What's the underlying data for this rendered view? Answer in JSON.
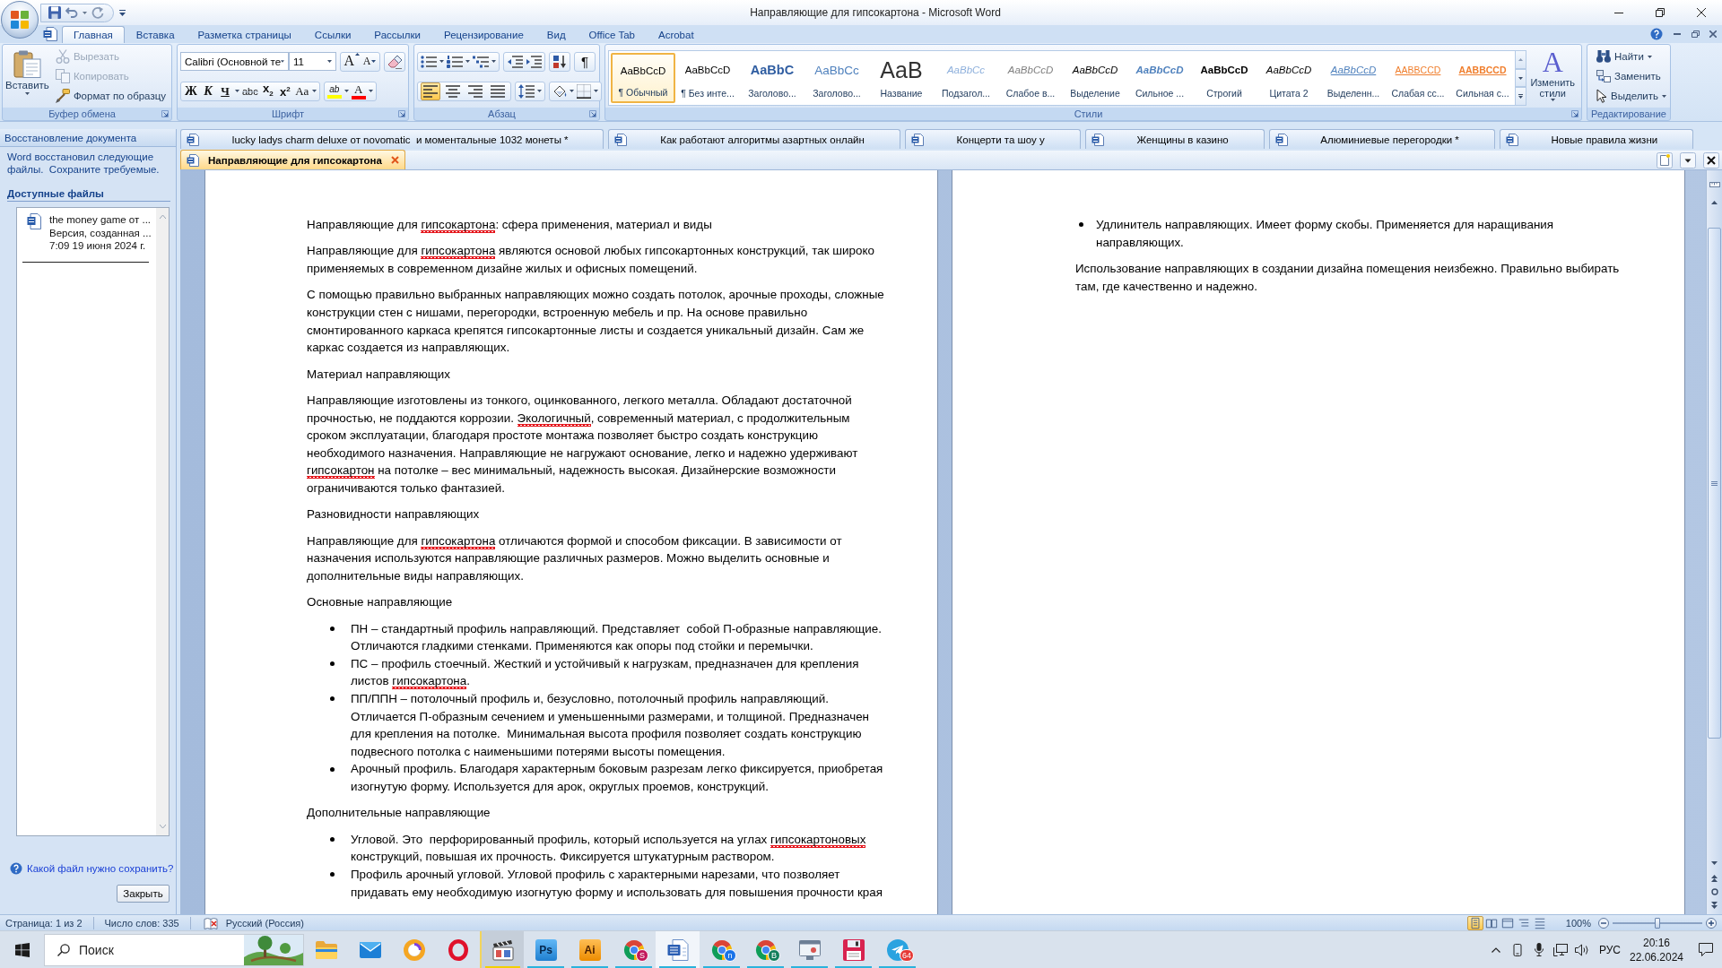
{
  "window": {
    "title": "Направляющие для гипсокартона - Microsoft Word"
  },
  "ribbon_tabs": [
    {
      "label": "Главная",
      "selected": true
    },
    {
      "label": "Вставка",
      "selected": false
    },
    {
      "label": "Разметка страницы",
      "selected": false
    },
    {
      "label": "Ссылки",
      "selected": false
    },
    {
      "label": "Рассылки",
      "selected": false
    },
    {
      "label": "Рецензирование",
      "selected": false
    },
    {
      "label": "Вид",
      "selected": false
    },
    {
      "label": "Office Tab",
      "selected": false
    },
    {
      "label": "Acrobat",
      "selected": false
    }
  ],
  "clipboard": {
    "title": "Буфер обмена",
    "paste": "Вставить",
    "cut": {
      "label": "Вырезать",
      "disabled": true
    },
    "copy": {
      "label": "Копировать",
      "disabled": true
    },
    "format_painter": {
      "label": "Формат по образцу",
      "disabled": false
    }
  },
  "font": {
    "title": "Шрифт",
    "family": "Calibri (Основной те",
    "size": "11",
    "grow": "A",
    "shrink": "A",
    "formats": [
      {
        "kind": "bold",
        "label": "Ж"
      },
      {
        "kind": "italic",
        "label": "К"
      },
      {
        "kind": "underline",
        "label": "Ч"
      },
      {
        "kind": "strike",
        "label": "abc"
      },
      {
        "kind": "subscript",
        "label": "x$_{2}$"
      },
      {
        "kind": "superscript",
        "label": "x$^{2}$"
      },
      {
        "kind": "case",
        "label": "Aa"
      }
    ],
    "highlight": {
      "label": "ab",
      "color": "#ffff00"
    },
    "font_color": {
      "label": "A",
      "color": "#ff0000"
    }
  },
  "paragraph": {
    "title": "Абзац",
    "marks": "¶",
    "alignment": [
      {
        "selected": true
      },
      {
        "selected": false
      },
      {
        "selected": false
      },
      {
        "selected": false
      }
    ]
  },
  "styles": {
    "title": "Стили",
    "items": [
      {
        "kind": "normal",
        "preview": "AaBbCcD",
        "label": "¶ Обычный",
        "selected": true
      },
      {
        "kind": "no-spacing",
        "preview": "AaBbCcD",
        "label": "¶ Без инте...",
        "selected": false
      },
      {
        "kind": "heading-1",
        "preview": "AaBbC",
        "label": "Заголово...",
        "selected": false
      },
      {
        "kind": "heading-2",
        "preview": "AaBbCc",
        "label": "Заголово...",
        "selected": false
      },
      {
        "kind": "title",
        "preview": "AaB",
        "label": "Название",
        "selected": false
      },
      {
        "kind": "subtitle",
        "preview": "AaBbCc",
        "label": "Подзагол...",
        "selected": false
      },
      {
        "kind": "subtle-emphasis",
        "preview": "AaBbCcD",
        "label": "Слабое в...",
        "selected": false
      },
      {
        "kind": "emphasis",
        "preview": "AaBbCcD",
        "label": "Выделение",
        "selected": false
      },
      {
        "kind": "intense-emphasis",
        "preview": "AaBbCcD",
        "label": "Сильное ...",
        "selected": false
      },
      {
        "kind": "strong",
        "preview": "AaBbCcD",
        "label": "Строгий",
        "selected": false
      },
      {
        "kind": "quote",
        "preview": "AaBbCcD",
        "label": "Цитата 2",
        "selected": false
      },
      {
        "kind": "intense-quote",
        "preview": "AaBbCcD",
        "label": "Выделенн...",
        "selected": false
      },
      {
        "kind": "subtle-reference",
        "preview": "AABBCCD",
        "label": "Слабая сс...",
        "selected": false
      },
      {
        "kind": "intense-reference",
        "preview": "AABBCCD",
        "label": "Сильная с...",
        "selected": false
      }
    ],
    "change": {
      "glyph": "A",
      "label": "Изменить стили"
    }
  },
  "editing": {
    "title": "Редактирование",
    "find": "Найти",
    "replace": "Заменить",
    "select": "Выделить"
  },
  "recovery": {
    "title": "Восстановление документа",
    "message": "Word восстановил следующие файлы.  Сохраните требуемые.",
    "section": "Доступные файлы",
    "files": [
      {
        "name": "the money game от ...",
        "version": "Версия, созданная ...",
        "time": "7:09 19 июня 2024 г."
      }
    ],
    "help": "Какой файл нужно сохранить?",
    "close": "Закрыть"
  },
  "document_tabs": {
    "rows": [
      {
        "tabs": [
          {
            "label": "lucky ladys charm deluxe от novomatic  и моментальные 1032 монеты *",
            "selected": false
          },
          {
            "label": "Как работают алгоритмы азартных онлайн",
            "selected": false
          },
          {
            "label": "Концерти та шоу у",
            "selected": false
          },
          {
            "label": "Женщины в казино",
            "selected": false
          },
          {
            "label": "Алюминиевые перегородки *",
            "selected": false
          },
          {
            "label": "Новые правила жизни",
            "selected": false
          }
        ]
      },
      {
        "tabs": [
          {
            "label": "Направляющие для гипсокартона",
            "selected": true
          }
        ]
      }
    ]
  },
  "pages": [
    {
      "blocks": [
        {
          "kind": "paragraph",
          "spans": [
            {
              "text": "Направляющие для ",
              "misspelled": false
            },
            {
              "text": "гипсокартона",
              "misspelled": true
            },
            {
              "text": ": сфера применения, материал и виды",
              "misspelled": false
            }
          ]
        },
        {
          "kind": "paragraph",
          "spans": [
            {
              "text": "Направляющие для ",
              "misspelled": false
            },
            {
              "text": "гипсокартона",
              "misspelled": true
            },
            {
              "text": " являются основой любых гипсокартонных конструкций, так широко применяемых в современном дизайне жилых и офисных помещений.",
              "misspelled": false
            }
          ]
        },
        {
          "kind": "paragraph",
          "spans": [
            {
              "text": "С помощью правильно выбранных направляющих можно создать потолок, арочные проходы, сложные конструкции стен с нишами, перегородки, встроенную мебель и пр. На основе правильно смонтированного каркаса крепятся гипсокартонные листы и создается уникальный дизайн. Сам же каркас создается из направляющих.",
              "misspelled": false
            }
          ]
        },
        {
          "kind": "paragraph",
          "spans": [
            {
              "text": "Материал направляющих",
              "misspelled": false
            }
          ]
        },
        {
          "kind": "paragraph",
          "spans": [
            {
              "text": "Направляющие изготовлены из тонкого, оцинкованного, легкого металла. Обладают достаточной прочностью, не поддаются коррозии. ",
              "misspelled": false
            },
            {
              "text": "Экологичный",
              "misspelled": true
            },
            {
              "text": ", современный материал, с продолжительным сроком эксплуатации, благодаря простоте монтажа позволяет быстро создать конструкцию необходимого назначения. Направляющие не нагружают основание, легко и надежно удерживают ",
              "misspelled": false
            },
            {
              "text": "гипсокартон",
              "misspelled": true
            },
            {
              "text": " на потолке – вес минимальный, надежность высокая. Дизайнерские возможности ограничиваются только фантазией.",
              "misspelled": false
            }
          ]
        },
        {
          "kind": "paragraph",
          "spans": [
            {
              "text": "Разновидности направляющих",
              "misspelled": false
            }
          ]
        },
        {
          "kind": "paragraph",
          "spans": [
            {
              "text": "Направляющие для ",
              "misspelled": false
            },
            {
              "text": "гипсокартона",
              "misspelled": true
            },
            {
              "text": " отличаются формой и способом фиксации. В зависимости от назначения используются направляющие различных размеров. Можно выделить основные и дополнительные виды направляющих.",
              "misspelled": false
            }
          ]
        },
        {
          "kind": "paragraph",
          "spans": [
            {
              "text": "Основные направляющие",
              "misspelled": false
            }
          ]
        },
        {
          "kind": "bullet",
          "spans": [
            {
              "text": "ПН – стандартный профиль направляющий. Представляет  собой П-образные направляющие. Отличаются гладкими стенками. Применяются как опоры под стойки и перемычки.",
              "misspelled": false
            }
          ]
        },
        {
          "kind": "bullet",
          "spans": [
            {
              "text": "ПС – профиль стоечный. Жесткий и устойчивый к нагрузкам, предназначен для крепления листов ",
              "misspelled": false
            },
            {
              "text": "гипсокартона",
              "misspelled": true
            },
            {
              "text": ".",
              "misspelled": false
            }
          ]
        },
        {
          "kind": "bullet",
          "spans": [
            {
              "text": "ПП/ППН – потолочный профиль и, безусловно, потолочный профиль направляющий. Отличается П-образным сечением и уменьшенными размерами, и толщиной. Предназначен для крепления на потолке.  Минимальная высота профиля позволяет создать конструкцию подвесного потолка с наименьшими потерями высоты помещения.",
              "misspelled": false
            }
          ]
        },
        {
          "kind": "bullet",
          "spans": [
            {
              "text": "Арочный профиль. Благодаря характерным боковым разрезам легко фиксируется, приобретая изогнутую форму. Используется для арок, округлых проемов, конструкций.",
              "misspelled": false
            }
          ]
        },
        {
          "kind": "paragraph",
          "spans": [
            {
              "text": "Дополнительные направляющие",
              "misspelled": false
            }
          ]
        },
        {
          "kind": "bullet",
          "spans": [
            {
              "text": "Угловой. Это  перфорированный профиль, который используется на углах ",
              "misspelled": false
            },
            {
              "text": "гипсокартоновых",
              "misspelled": true
            },
            {
              "text": " конструкций, повышая их прочность. Фиксируется штукатурным раствором.",
              "misspelled": false
            }
          ]
        },
        {
          "kind": "bullet",
          "spans": [
            {
              "text": "Профиль арочный угловой. Угловой профиль с характерными нарезами, что позволяет придавать ему необходимую изогнутую форму и использовать для повышения прочности края",
              "misspelled": false
            }
          ]
        }
      ]
    },
    {
      "blocks": [
        {
          "kind": "bullet",
          "spans": [
            {
              "text": "Удлинитель направляющих. Имеет форму скобы. Применяется для наращивания направляющих.",
              "misspelled": false
            }
          ]
        },
        {
          "kind": "paragraph",
          "spans": [
            {
              "text": "Использование направляющих в создании дизайна помещения неизбежно. Правильно выбирать там, где качественно и надежно.",
              "misspelled": false
            }
          ]
        }
      ]
    }
  ],
  "status_bar": {
    "page": "Страница: 1 из 2",
    "words": "Число слов: 335",
    "language": "Русский (Россия)",
    "views": [
      {
        "selected": true
      },
      {
        "selected": false
      },
      {
        "selected": false
      },
      {
        "selected": false
      },
      {
        "selected": false
      }
    ],
    "zoom": "100%",
    "zoom_slider": {
      "level": 0.5
    }
  },
  "taskbar": {
    "search": {
      "placeholder": "Поиск"
    },
    "apps": [
      {
        "running": false,
        "active": false,
        "flashing": false
      },
      {
        "running": false,
        "active": false,
        "flashing": false
      },
      {
        "running": false,
        "active": false,
        "flashing": false
      },
      {
        "running": false,
        "active": false,
        "flashing": false
      },
      {
        "running": true,
        "active": false,
        "flashing": true
      },
      {
        "running": true,
        "active": false,
        "flashing": false,
        "label": "Ps"
      },
      {
        "running": true,
        "active": false,
        "flashing": false,
        "label": "Ai"
      },
      {
        "running": true,
        "active": false,
        "flashing": false,
        "badge": {
          "text": "S",
          "color": "#c2185b"
        }
      },
      {
        "running": true,
        "active": true,
        "flashing": false
      },
      {
        "running": true,
        "active": false,
        "flashing": false,
        "badge": {
          "text": "n",
          "color": "#1a73e8"
        }
      },
      {
        "running": true,
        "active": false,
        "flashing": false,
        "badge": {
          "text": "B",
          "color": "#137e5c"
        }
      },
      {
        "running": true,
        "active": false,
        "flashing": false
      },
      {
        "running": true,
        "active": false,
        "flashing": false
      },
      {
        "running": true,
        "active": false,
        "flashing": false,
        "badge": {
          "text": "64",
          "color": "#e53935"
        }
      }
    ],
    "tray": {
      "language": "РУС",
      "time": "20:16",
      "date": "22.06.2024"
    }
  }
}
